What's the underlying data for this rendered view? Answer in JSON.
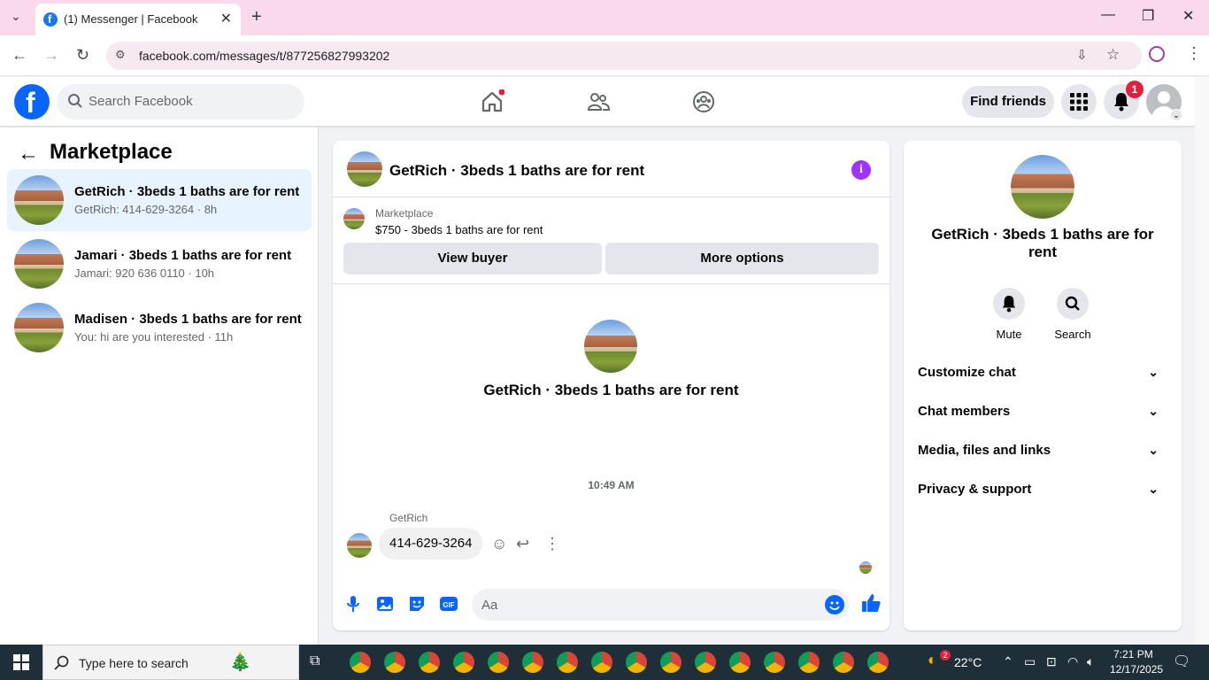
{
  "browser": {
    "tab_title": "(1) Messenger | Facebook",
    "url": "facebook.com/messages/t/877256827993202"
  },
  "fbnav": {
    "search_placeholder": "Search Facebook",
    "find_friends": "Find friends",
    "notification_count": "1",
    "brand_color": "#0866ff"
  },
  "left": {
    "title": "Marketplace",
    "conversations": [
      {
        "name": "GetRich · 3beds 1 baths are for rent",
        "snippet": "GetRich: 414-629-3264 · 8h",
        "selected": true
      },
      {
        "name": "Jamari · 3beds 1 baths are for rent",
        "snippet": "Jamari: 920 636 0110 · 10h",
        "selected": false
      },
      {
        "name": "Madisen · 3beds 1 baths are for rent",
        "snippet": "You: hi are you interested · 11h",
        "selected": false
      }
    ]
  },
  "chat": {
    "title": "GetRich · 3beds 1 baths are for rent",
    "marketplace_label": "Marketplace",
    "listing": "$750 - 3beds 1 baths are for rent",
    "view_buyer": "View buyer",
    "more_options": "More options",
    "intro_name": "GetRich · 3beds 1 baths are for rent",
    "timestamp": "10:49 AM",
    "sender": "GetRich",
    "message": "414-629-3264",
    "composer_placeholder": "Aa"
  },
  "right": {
    "name": "GetRich · 3beds 1 baths are for rent",
    "mute": "Mute",
    "search": "Search",
    "sections": [
      "Customize chat",
      "Chat members",
      "Media, files and links",
      "Privacy & support"
    ]
  },
  "taskbar": {
    "search_placeholder": "Type here to search",
    "weather": "22°C",
    "time": "7:21 PM",
    "date": "12/17/2025",
    "weather_badge": "2"
  }
}
